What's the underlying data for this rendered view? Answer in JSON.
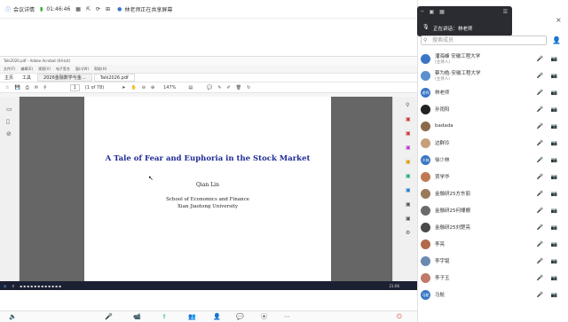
{
  "topbar": {
    "meeting_details": "会议详情",
    "timer": "01:46:46",
    "sharing_notice": "林老师正在共享屏幕"
  },
  "acrobat": {
    "window_title": "Talk2026.pdf - Adobe Acrobat (64-bit)",
    "menu": [
      "文件(F)",
      "编辑(E)",
      "视图(V)",
      "电子签名",
      "窗口(W)",
      "帮助(H)"
    ],
    "tabs": {
      "home": "主页",
      "tools": "工具",
      "doc1": "2026金融数学与金…",
      "doc2": "Talk2026.pdf"
    },
    "page_indicator": "(1 of 78)",
    "page_number": "1",
    "zoom": "147%"
  },
  "pdf_page": {
    "title": "A Tale of Fear and Euphoria in the Stock Market",
    "author": "Qian Lin",
    "affiliation1": "School of Economics and Finance",
    "affiliation2": "Xian Jiaotong University"
  },
  "taskbar": {
    "time": "21:06"
  },
  "panel": {
    "speaking_label": "正在讲话：",
    "speaking_name": "林老师",
    "search_placeholder": "搜索成员",
    "members": [
      {
        "name": "潘海峰 安徽工程大学",
        "sub": "(主持人)",
        "avatar_color": "#3a76c4"
      },
      {
        "name": "蔡为皓-安徽工程大学",
        "sub": "(主持人)",
        "avatar_color": "#5b8fd0"
      },
      {
        "name": "林老师",
        "sub": "",
        "avatar_color": "#3a76c4",
        "avatar_text": "老师"
      },
      {
        "name": "孙雨阳",
        "sub": "",
        "avatar_color": "#222222"
      },
      {
        "name": "badada",
        "sub": "",
        "avatar_color": "#8a6a4a"
      },
      {
        "name": "边群玲",
        "sub": "",
        "avatar_color": "#c5a07a"
      },
      {
        "name": "徐少林",
        "sub": "",
        "avatar_color": "#3a76c4",
        "avatar_text": "少林"
      },
      {
        "name": "贾学华",
        "sub": "",
        "avatar_color": "#c07a52"
      },
      {
        "name": "金融研25方东丽",
        "sub": "",
        "avatar_color": "#9a7a5a"
      },
      {
        "name": "金融研25何姗姗",
        "sub": "",
        "avatar_color": "#6a6a6a"
      },
      {
        "name": "金融研25刘楚亮",
        "sub": "",
        "avatar_color": "#4a4a4a"
      },
      {
        "name": "李亮",
        "sub": "",
        "avatar_color": "#b06a4a"
      },
      {
        "name": "李宇锟",
        "sub": "",
        "avatar_color": "#6a8ab0"
      },
      {
        "name": "李子玉",
        "sub": "",
        "avatar_color": "#c07a6a"
      },
      {
        "name": "马航",
        "sub": "",
        "avatar_color": "#3a76c4",
        "avatar_text": "马航"
      }
    ]
  }
}
